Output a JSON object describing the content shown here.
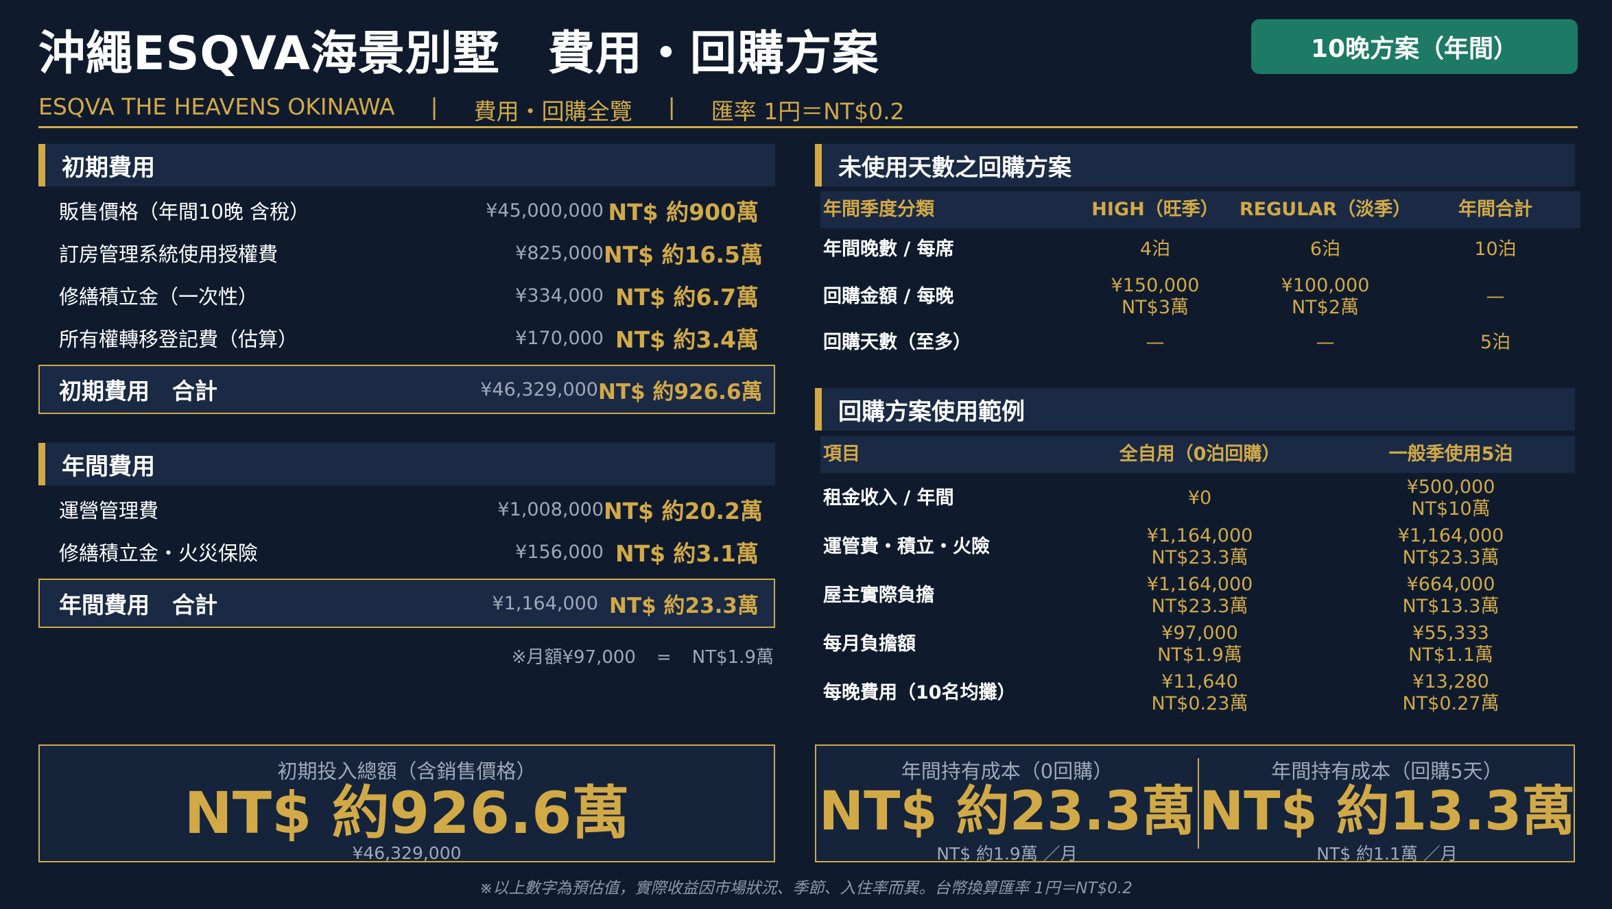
{
  "header": {
    "title_main": "沖繩ESQVA海景別墅",
    "title_sub": "費用・回購方案",
    "badge": "10晚方案（年間）",
    "subtitle_brand": "ESQVA THE HEAVENS OKINAWA",
    "subtitle_sep1": "|",
    "subtitle_mid": "費用・回購全覽",
    "subtitle_sep2": "|",
    "subtitle_rate": "匯率 1円＝NT$0.2"
  },
  "initial": {
    "heading": "初期費用",
    "rows": [
      {
        "label": "販售價格（年間10晚 含稅）",
        "yen": "¥45,000,000",
        "ntd": "NT$ 約900萬"
      },
      {
        "label": "訂房管理系統使用授權費",
        "yen": "¥825,000",
        "ntd": "NT$ 約16.5萬"
      },
      {
        "label": "修繕積立金（一次性）",
        "yen": "¥334,000",
        "ntd": "NT$ 約6.7萬"
      },
      {
        "label": "所有權轉移登記費（估算）",
        "yen": "¥170,000",
        "ntd": "NT$ 約3.4萬"
      }
    ],
    "total": {
      "label": "初期費用　合計",
      "yen": "¥46,329,000",
      "ntd": "NT$ 約926.6萬"
    }
  },
  "annual": {
    "heading": "年間費用",
    "rows": [
      {
        "label": "運營管理費",
        "yen": "¥1,008,000",
        "ntd": "NT$ 約20.2萬"
      },
      {
        "label": "修繕積立金・火災保險",
        "yen": "¥156,000",
        "ntd": "NT$ 約3.1萬"
      }
    ],
    "total": {
      "label": "年間費用　合計",
      "yen": "¥1,164,000",
      "ntd": "NT$ 約23.3萬"
    },
    "note_left": "※月額¥97,000",
    "note_eq": "=",
    "note_right": "NT$1.9萬"
  },
  "buyback": {
    "heading": "未使用天數之回購方案",
    "columns": [
      "年間季度分類",
      "HIGH（旺季）",
      "REGULAR（淡季）",
      "年間合計"
    ],
    "rows": [
      {
        "label": "年間晚數 / 每席",
        "c1": "4泊",
        "c1b": "",
        "c2": "6泊",
        "c2b": "",
        "c3": "10泊"
      },
      {
        "label": "回購金額 / 每晚",
        "c1": "¥150,000",
        "c1b": "NT$3萬",
        "c2": "¥100,000",
        "c2b": "NT$2萬",
        "c3": "—"
      },
      {
        "label": "回購天數（至多）",
        "c1": "—",
        "c1b": "",
        "c2": "—",
        "c2b": "",
        "c3": "5泊"
      }
    ]
  },
  "example": {
    "heading": "回購方案使用範例",
    "columns": [
      "項目",
      "全自用（0泊回購）",
      "一般季使用5泊"
    ],
    "rows": [
      {
        "label": "租金收入 / 年間",
        "a1": "¥0",
        "a2": "",
        "b1": "¥500,000",
        "b2": "NT$10萬"
      },
      {
        "label": "運管費・積立・火險",
        "a1": "¥1,164,000",
        "a2": "NT$23.3萬",
        "b1": "¥1,164,000",
        "b2": "NT$23.3萬"
      },
      {
        "label": "屋主實際負擔",
        "a1": "¥1,164,000",
        "a2": "NT$23.3萬",
        "b1": "¥664,000",
        "b2": "NT$13.3萬"
      },
      {
        "label": "每月負擔額",
        "a1": "¥97,000",
        "a2": "NT$1.9萬",
        "b1": "¥55,333",
        "b2": "NT$1.1萬"
      },
      {
        "label": "每晚費用（10名均攤）",
        "a1": "¥11,640",
        "a2": "NT$0.23萬",
        "b1": "¥13,280",
        "b2": "NT$0.27萬"
      }
    ]
  },
  "summary": {
    "initial": {
      "caption": "初期投入總額（含銷售價格）",
      "value": "NT$ 約926.6萬",
      "sub": "¥46,329,000"
    },
    "hold0": {
      "caption": "年間持有成本（0回購）",
      "value": "NT$ 約23.3萬",
      "sub": "NT$ 約1.9萬 ／月"
    },
    "hold5": {
      "caption": "年間持有成本（回購5天）",
      "value": "NT$ 約13.3萬",
      "sub": "NT$ 約1.1萬 ／月"
    }
  },
  "footer": "※以上數字為預估值，實際收益因市場狀況、季節、入住率而異。台幣換算匯率 1円＝NT$0.2",
  "colors": {
    "background": "#0f1b2d",
    "gold": "#d2a947",
    "panel": "#1a2a44",
    "badge": "#1d7a64"
  }
}
